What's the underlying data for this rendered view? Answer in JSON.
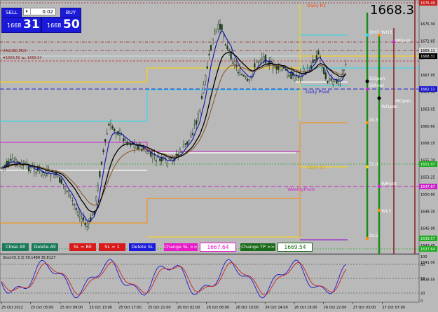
{
  "trade_panel": {
    "sell_label": "SELL",
    "buy_label": "BUY",
    "lot_value": "0.02",
    "arrow": "▾",
    "sell_small": "1668",
    "sell_big": "31",
    "buy_small": "1668",
    "buy_big": "50"
  },
  "big_price": "1668.3",
  "price_axis": {
    "ticks": [
      "1675.30",
      "1672.85",
      "1670.40",
      "1667.95",
      "1665.50",
      "1663.05",
      "1660.60",
      "1658.15",
      "1655.70",
      "1653.25",
      "1650.80",
      "1648.35",
      "1645.90",
      "1643.45",
      "1641.00",
      "1638.55"
    ],
    "tags": [
      "1676.49",
      "1669.11",
      "1668.31",
      "1662.11",
      "1651.07",
      "1647.67",
      "1639.57",
      "1637.64"
    ]
  },
  "time_axis": [
    "25 Oct 2022",
    "25 Oct 05:00",
    "25 Oct 09:00",
    "25 Oct 13:00",
    "25 Oct 17:00",
    "25 Oct 21:00",
    "26 Oct 02:00",
    "26 Oct 06:00",
    "26 Oct 10:00",
    "26 Oct 14:00",
    "26 Oct 18:00",
    "26 Oct 22:00",
    "27 Oct 03:00",
    "27 Oct 07:00"
  ],
  "level_labels": {
    "daily_r1": "Daily R1",
    "daily_pivot": "Daily Pivot",
    "daily_s1": "Daily S1",
    "weekly_pivot": "WeeklyPivot",
    "dh3": "DH3",
    "wh3": "WH3",
    "mpivot": "MPivot",
    "dopen": "DOpen",
    "dpivot": "DPivot",
    "mopen": "MOpen",
    "wopen": "WOpen",
    "dl3": "DL3",
    "dl4": "DL4",
    "wpivot": "WPivot",
    "wl3": "WL3",
    "dl5": "DL5"
  },
  "top_line_labels": {
    "line1": "XAUUSD,M15",
    "line2": "#1668.50 tp: 1669.54"
  },
  "bottom_bar": {
    "close_all": "Close All",
    "delete_all": "Delete All",
    "sl_be": "SL = BE",
    "sl_1": "SL = 1",
    "delete_sl": "Delete SL",
    "change_sl": "Change SL >>",
    "sl_value": "1667.64",
    "change_tp": "Change TP >>",
    "tp_value": "1669.54"
  },
  "stoch": {
    "label": "Stoch(5,3,3) 59.1489 35.8127",
    "ticks": [
      "100",
      "80",
      "50",
      "20",
      "0"
    ]
  },
  "colors": {
    "background": "#b9b9b9",
    "sell_buy_panel": "#1a1ad8",
    "daily_r1": "#ff8c00",
    "daily_s1": "#d4a017",
    "pivot": "#2222cc",
    "weekly_pivot": "#cc22cc",
    "cyan": "#22ddee",
    "green_bar": "#1a8a1a"
  }
}
